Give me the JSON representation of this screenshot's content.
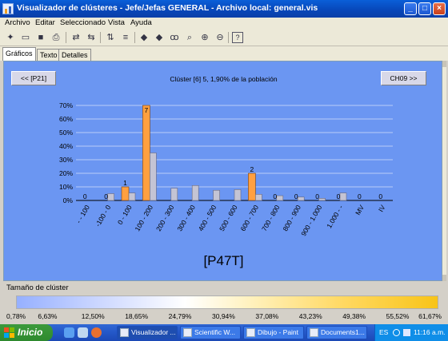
{
  "window": {
    "title": "Visualizador de clústeres - Jefe/Jefas GENERAL - Archivo local: general.vis"
  },
  "menu": [
    "Archivo",
    "Editar",
    "Seleccionado",
    "Vista",
    "Ayuda"
  ],
  "toolbar_icons": [
    "new-icon",
    "open-icon",
    "save-icon",
    "print-icon",
    "swap-icon",
    "swap-alt-icon",
    "sort-icon",
    "sort-alt-icon",
    "arrow-left-icon",
    "arrow-right-icon",
    "binoculars-icon",
    "find-icon",
    "select-icon",
    "zoom-in-icon",
    "zoom-out-icon",
    "help-icon"
  ],
  "tabs": [
    "Gráficos",
    "Texto",
    "Detalles"
  ],
  "panel": {
    "prev_button": "<< [P21]",
    "next_button": "CH09 >>",
    "cluster_title": "Clúster [6] 5, 1,90% de la población",
    "variable_label": "[P47T]"
  },
  "chart_data": {
    "type": "bar",
    "categories": [
      "- - 100",
      "-100 - 0",
      "0 - 100",
      "100 - 200",
      "200 - 300",
      "300 - 400",
      "400 - 500",
      "500 - 600",
      "600 - 700",
      "700 - 800",
      "800 - 900",
      "900 - 1.000",
      "1.000 - -",
      "MV",
      "IV"
    ],
    "series": [
      {
        "values": [
          0,
          0,
          10,
          70,
          0,
          0,
          0,
          0,
          20,
          0,
          0,
          0,
          0,
          0,
          0
        ],
        "color": "#ffa040"
      },
      {
        "values": [
          0,
          5,
          5.5,
          35,
          9,
          11,
          7.5,
          8,
          4.5,
          3.5,
          2.5,
          1.5,
          5.5,
          0,
          0
        ],
        "color": "#c4c4d4"
      }
    ],
    "bar_labels": [
      "0",
      "0",
      "1",
      "7",
      "",
      "",
      "",
      "",
      "2",
      "0",
      "0",
      "0",
      "0",
      "0",
      "0"
    ],
    "y_ticks": [
      "70%",
      "60%",
      "50%",
      "40%",
      "30%",
      "20%",
      "10%",
      "0%"
    ],
    "ylim": [
      0,
      70
    ]
  },
  "legend": {
    "label": "Tamaño de clúster",
    "scale": [
      "0,78%",
      "6,63%",
      "12,50%",
      "18,65%",
      "24,79%",
      "30,94%",
      "37,08%",
      "43,23%",
      "49,38%",
      "55,52%",
      "61,67%"
    ]
  },
  "taskbar": {
    "start": "Inicio",
    "tasks": [
      "Visualizador ...",
      "Scientific W...",
      "Dibujo - Paint",
      "Documents1..."
    ],
    "lang": "ES",
    "clock": "11:16 a.m."
  },
  "colors": {
    "panel": "#6b96f2",
    "highlight_bar": "#ffa040",
    "base_bar": "#c4c4d4"
  }
}
